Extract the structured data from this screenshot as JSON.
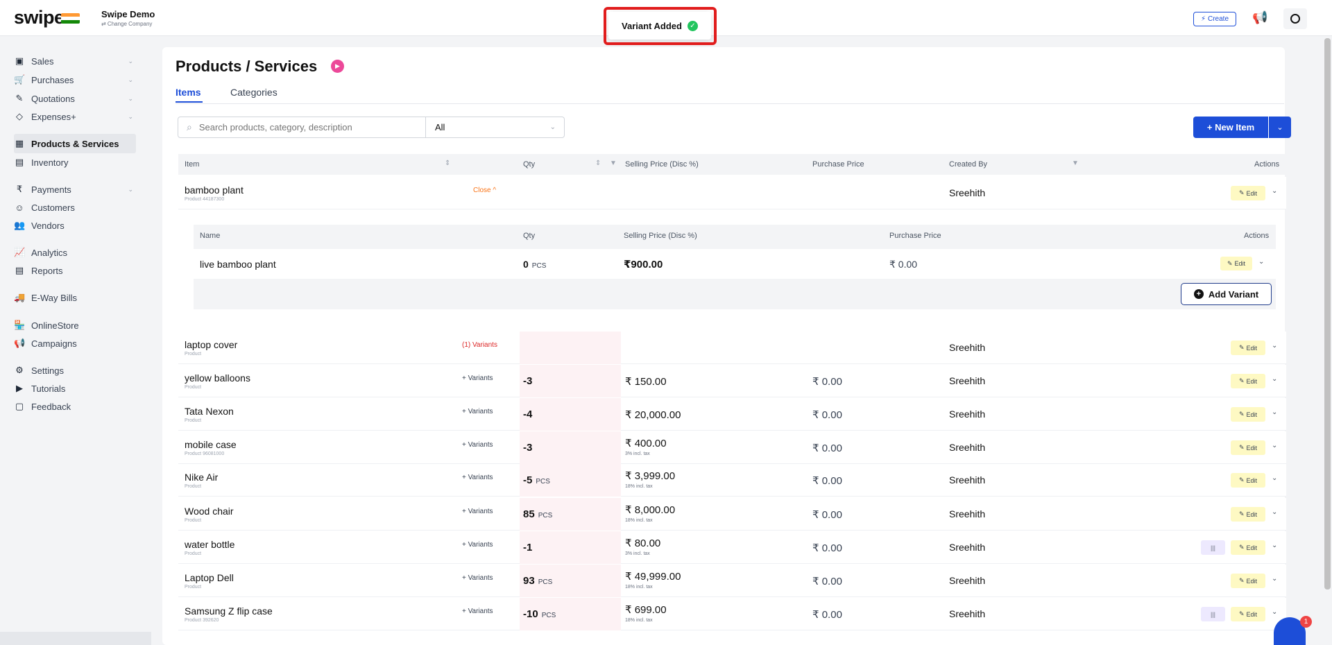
{
  "brand": {
    "logo": "swipe",
    "company": "Swipe Demo",
    "change_company": "⇄ Change Company"
  },
  "toast": {
    "text": "Variant Added"
  },
  "topbar": {
    "create_label": "Create"
  },
  "sidebar": {
    "items": [
      {
        "label": "Sales",
        "icon": "sales-icon",
        "has_chevron": true
      },
      {
        "label": "Purchases",
        "icon": "cart-icon",
        "has_chevron": true
      },
      {
        "label": "Quotations",
        "icon": "pen-icon",
        "has_chevron": true
      },
      {
        "label": "Expenses+",
        "icon": "tag-icon",
        "has_chevron": true
      },
      {
        "label": "Products & Services",
        "icon": "box-icon",
        "active": true
      },
      {
        "label": "Inventory",
        "icon": "inventory-icon"
      },
      {
        "label": "Payments",
        "icon": "rupee-icon",
        "has_chevron": true
      },
      {
        "label": "Customers",
        "icon": "user-icon"
      },
      {
        "label": "Vendors",
        "icon": "users-icon"
      },
      {
        "label": "Analytics",
        "icon": "chart-icon"
      },
      {
        "label": "Reports",
        "icon": "report-icon"
      },
      {
        "label": "E-Way Bills",
        "icon": "truck-icon"
      },
      {
        "label": "OnlineStore",
        "icon": "store-icon"
      },
      {
        "label": "Campaigns",
        "icon": "megaphone-icon"
      },
      {
        "label": "Settings",
        "icon": "gear-icon"
      },
      {
        "label": "Tutorials",
        "icon": "play-icon"
      },
      {
        "label": "Feedback",
        "icon": "chat-icon"
      }
    ]
  },
  "page": {
    "title": "Products / Services",
    "tabs": [
      {
        "label": "Items",
        "active": true
      },
      {
        "label": "Categories"
      }
    ],
    "search_placeholder": "Search products, category, description",
    "filter_value": "All",
    "new_item_label": "+ New Item"
  },
  "table": {
    "headers": {
      "item": "Item",
      "qty": "Qty",
      "selling": "Selling Price (Disc %)",
      "purchase": "Purchase Price",
      "created": "Created By",
      "actions": "Actions"
    },
    "expanded": {
      "name": "bamboo plant",
      "sub": "Product  44187300",
      "close_label": "Close ^",
      "created_by": "Sreehith",
      "variant_headers": {
        "name": "Name",
        "qty": "Qty",
        "selling": "Selling Price (Disc %)",
        "purchase": "Purchase Price",
        "actions": "Actions"
      },
      "variant": {
        "name": "live bamboo plant",
        "qty": "0",
        "unit": "PCS",
        "price": "₹900.00",
        "purchase": "₹ 0.00"
      },
      "add_variant_label": "Add Variant"
    },
    "rows": [
      {
        "name": "laptop cover",
        "sub": "Product",
        "variants": "(1) Variants",
        "qty": "",
        "unit": "",
        "price": "",
        "price_sub": "",
        "purchase": "",
        "created_by": "Sreehith"
      },
      {
        "name": "yellow balloons",
        "sub": "Product",
        "variants": "+ Variants",
        "qty": "-3",
        "unit": "",
        "price": "₹ 150.00",
        "price_sub": "",
        "purchase": "₹ 0.00",
        "created_by": "Sreehith"
      },
      {
        "name": "Tata Nexon",
        "sub": "Product",
        "variants": "+ Variants",
        "qty": "-4",
        "unit": "",
        "price": "₹ 20,000.00",
        "price_sub": "",
        "purchase": "₹ 0.00",
        "created_by": "Sreehith"
      },
      {
        "name": "mobile case",
        "sub": "Product  96081000",
        "variants": "+ Variants",
        "qty": "-3",
        "unit": "",
        "price": "₹ 400.00",
        "price_sub": "3% incl. tax",
        "purchase": "₹ 0.00",
        "created_by": "Sreehith"
      },
      {
        "name": "Nike Air",
        "sub": "Product",
        "variants": "+ Variants",
        "qty": "-5",
        "unit": "PCS",
        "price": "₹ 3,999.00",
        "price_sub": "18% incl. tax",
        "purchase": "₹ 0.00",
        "created_by": "Sreehith"
      },
      {
        "name": "Wood chair",
        "sub": "Product",
        "variants": "+ Variants",
        "qty": "85",
        "unit": "PCS",
        "price": "₹ 8,000.00",
        "price_sub": "18% incl. tax",
        "purchase": "₹ 0.00",
        "created_by": "Sreehith"
      },
      {
        "name": "water bottle",
        "sub": "Product",
        "variants": "+ Variants",
        "qty": "-1",
        "unit": "",
        "price": "₹ 80.00",
        "price_sub": "3% incl. tax",
        "purchase": "₹ 0.00",
        "created_by": "Sreehith",
        "barcode": true
      },
      {
        "name": "Laptop Dell",
        "sub": "Product",
        "variants": "+ Variants",
        "qty": "93",
        "unit": "PCS",
        "price": "₹ 49,999.00",
        "price_sub": "18% incl. tax",
        "purchase": "₹ 0.00",
        "created_by": "Sreehith"
      },
      {
        "name": "Samsung Z flip case",
        "sub": "Product  392620",
        "variants": "+ Variants",
        "qty": "-10",
        "unit": "PCS",
        "price": "₹ 699.00",
        "price_sub": "18% incl. tax",
        "purchase": "₹ 0.00",
        "created_by": "Sreehith",
        "barcode": true
      }
    ],
    "edit_label": "Edit"
  },
  "colors": {
    "accent": "#1d4ed8",
    "toast_outline": "#e11d1d",
    "edit_bg": "#fef9c3",
    "qty_bg": "#fdf2f4"
  },
  "chat": {
    "badge_count": "1"
  }
}
